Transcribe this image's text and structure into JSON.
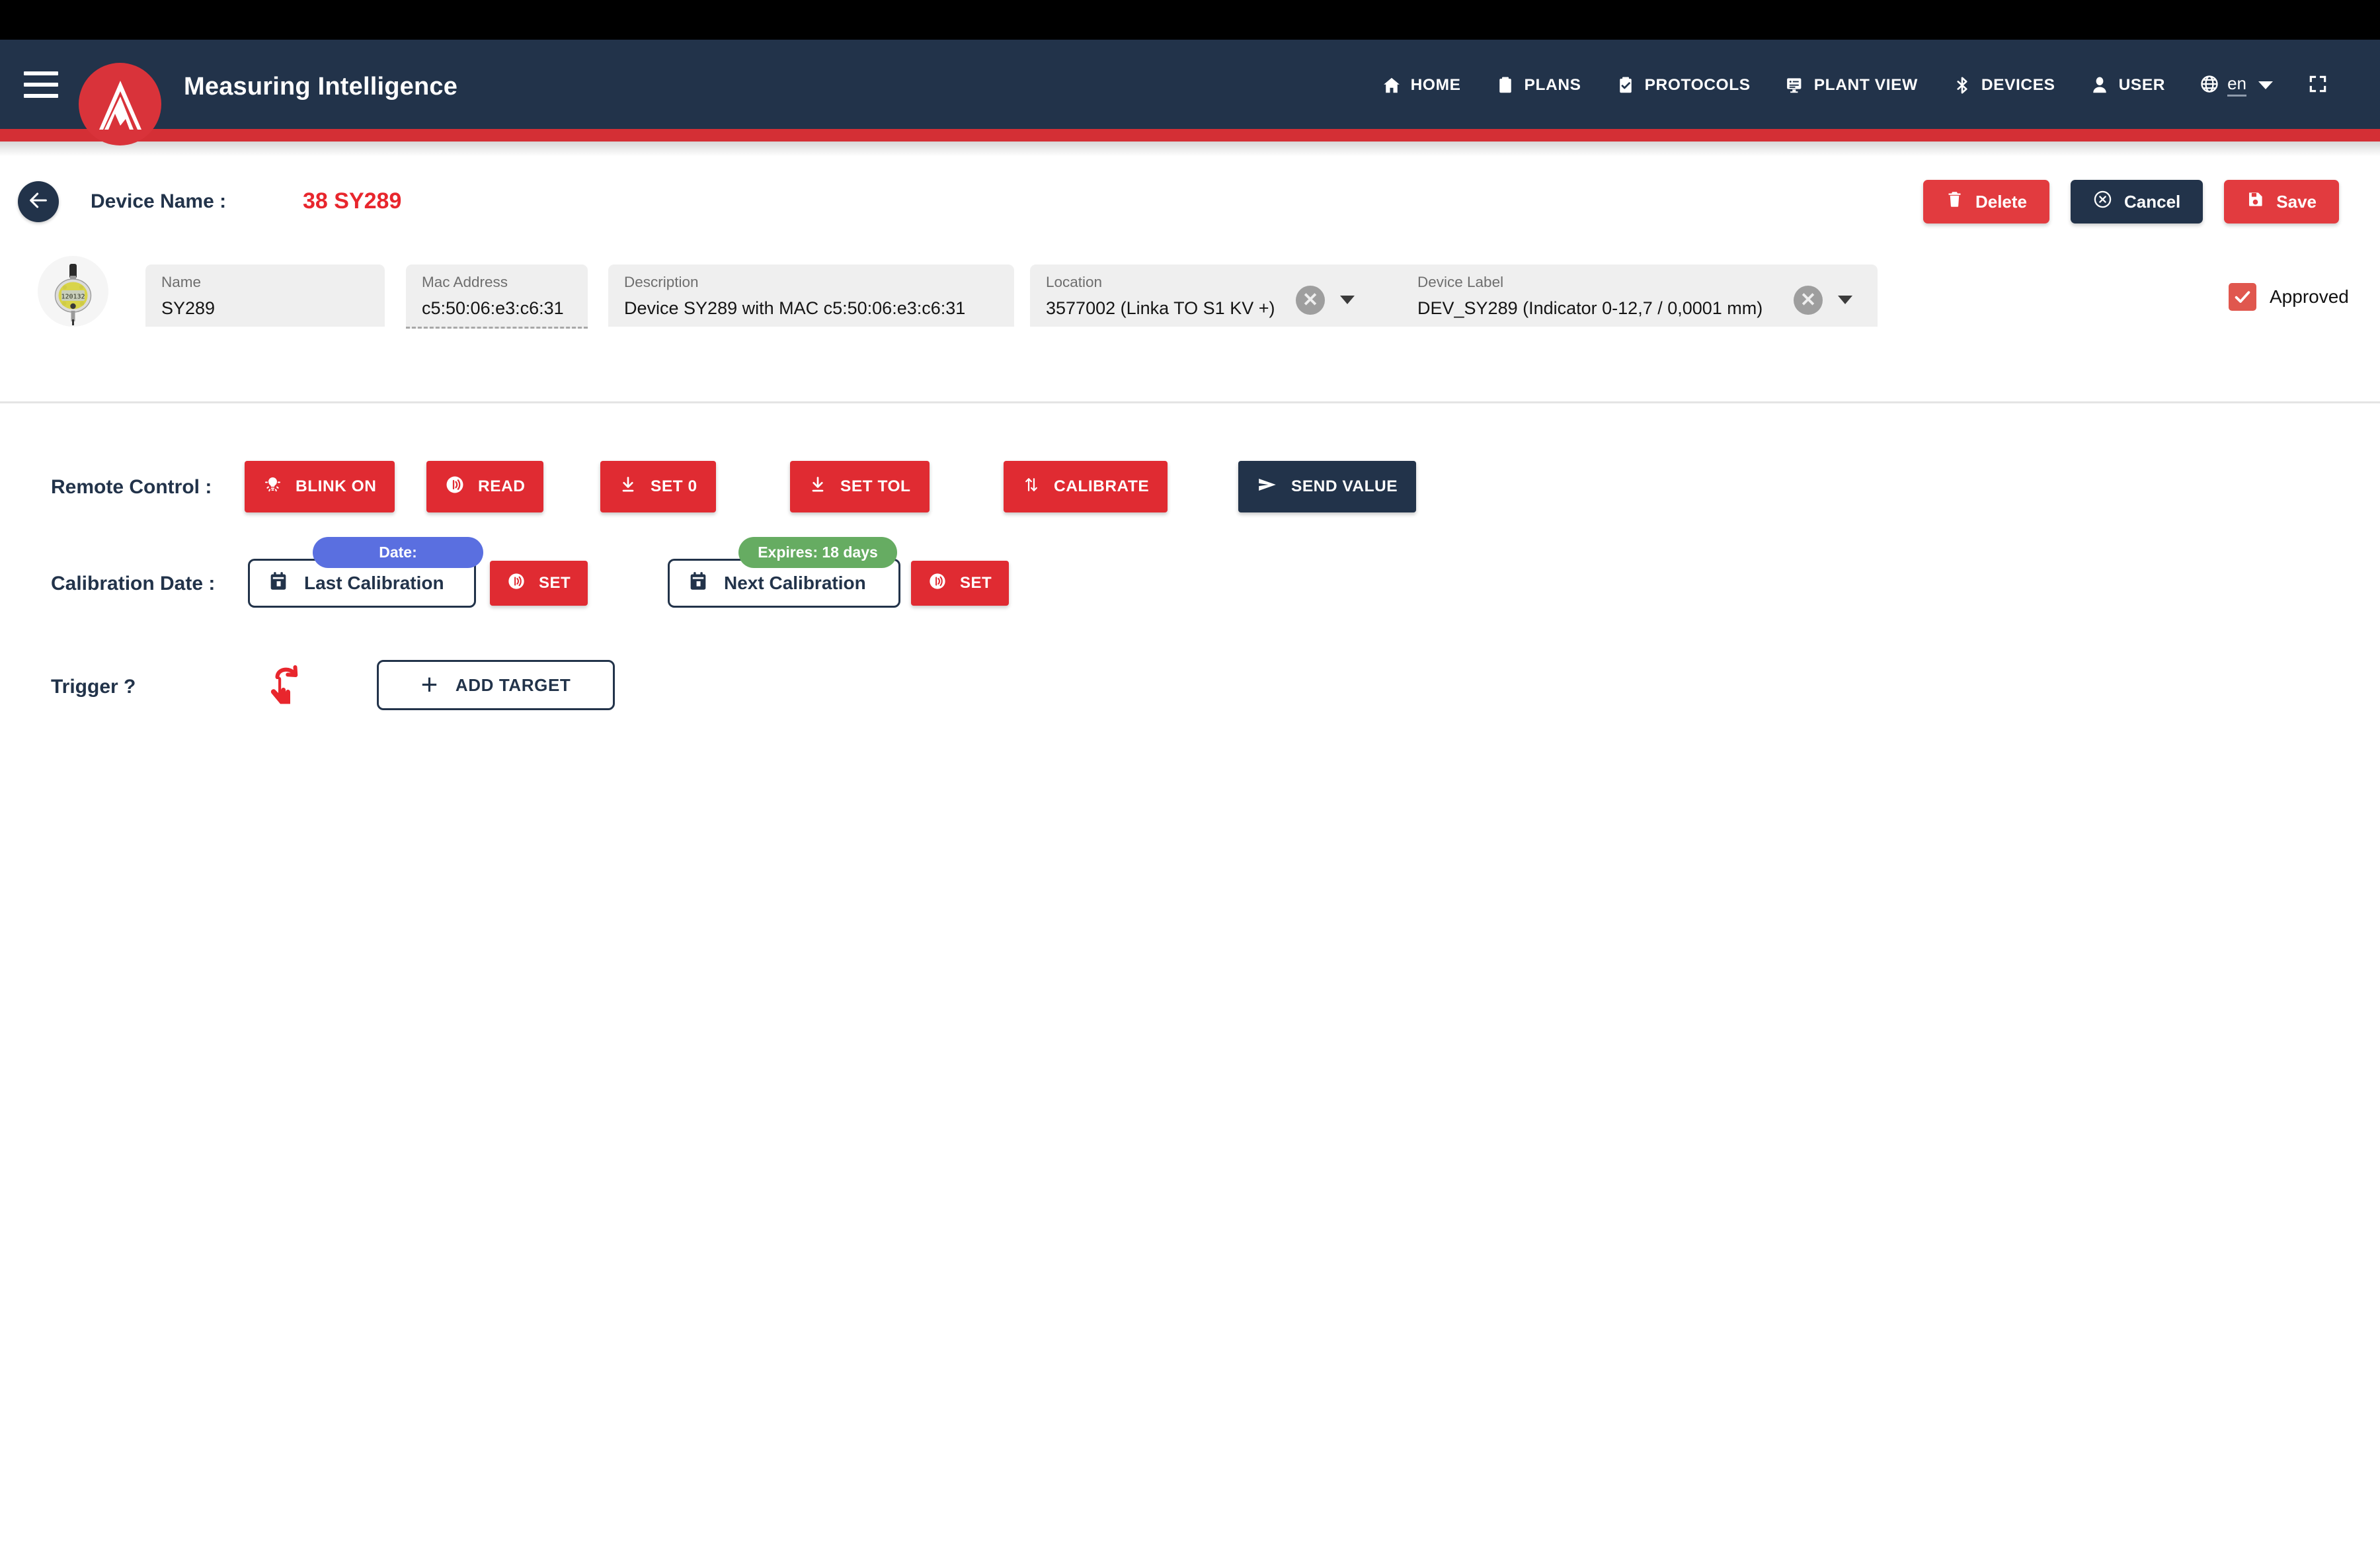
{
  "app": {
    "title": "Measuring Intelligence",
    "logo_icon": "mountain-peak-logo",
    "menu_icon": "hamburger-menu-icon",
    "accent_red": "#d42f35",
    "navy": "#22334a"
  },
  "nav": {
    "items": [
      {
        "label": "HOME",
        "icon": "home-icon"
      },
      {
        "label": "PLANS",
        "icon": "clipboard-icon"
      },
      {
        "label": "PROTOCOLS",
        "icon": "clipboard-check-icon"
      },
      {
        "label": "PLANT VIEW",
        "icon": "plant-view-icon"
      },
      {
        "label": "DEVICES",
        "icon": "bluetooth-icon"
      },
      {
        "label": "USER",
        "icon": "person-icon"
      }
    ],
    "language": {
      "value": "en",
      "icon": "globe-icon",
      "caret": "chevron-down-icon"
    },
    "fullscreen_icon": "fullscreen-icon"
  },
  "header": {
    "back_icon": "arrow-left-icon",
    "device_name_label": "Device Name :",
    "device_name_value": "38 SY289",
    "actions": [
      {
        "label": "Delete",
        "icon": "trash-icon",
        "style": "red"
      },
      {
        "label": "Cancel",
        "icon": "circle-x-icon",
        "style": "dark"
      },
      {
        "label": "Save",
        "icon": "save-disk-icon",
        "style": "red"
      }
    ]
  },
  "device": {
    "thumbnail_icon": "dial-indicator-thumbnail",
    "fields": [
      {
        "label": "Name",
        "value": "SY289",
        "type": "text",
        "disabled": false
      },
      {
        "label": "Mac Address",
        "value": "c5:50:06:e3:c6:31",
        "type": "text",
        "disabled": true
      },
      {
        "label": "Description",
        "value": "Device SY289 with MAC c5:50:06:e3:c6:31",
        "type": "text",
        "disabled": false
      },
      {
        "label": "Location",
        "value": "3577002 (Linka TO S1 KV +)",
        "type": "select",
        "disabled": false
      },
      {
        "label": "Device Label",
        "value": "DEV_SY289 (Indicator 0-12,7 / 0,0001 mm)",
        "type": "select",
        "disabled": false
      }
    ],
    "clear_icon": "clear-circle-icon",
    "dropdown_icon": "caret-down-icon",
    "approved": {
      "label": "Approved",
      "checked": true,
      "icon": "checkmark-icon",
      "color": "#e0574e"
    }
  },
  "remote_control": {
    "label": "Remote Control :",
    "buttons": [
      {
        "label": "BLINK ON",
        "icon": "lightbulb-icon",
        "style": "red"
      },
      {
        "label": "READ",
        "icon": "signal-wave-icon",
        "style": "red"
      },
      {
        "label": "SET 0",
        "icon": "download-icon",
        "style": "red"
      },
      {
        "label": "SET TOL",
        "icon": "download-icon",
        "style": "red"
      },
      {
        "label": "CALIBRATE",
        "icon": "up-down-arrows-icon",
        "style": "red"
      },
      {
        "label": "SEND VALUE",
        "icon": "send-icon",
        "style": "dark"
      }
    ]
  },
  "calibration": {
    "label": "Calibration Date :",
    "last": {
      "button_label": "Last Calibration",
      "icon": "calendar-icon",
      "badge": {
        "text": "Date:",
        "color": "#5a6fe0"
      },
      "set_label": "SET",
      "set_icon": "signal-wave-icon"
    },
    "next": {
      "button_label": "Next Calibration",
      "icon": "calendar-icon",
      "badge": {
        "text": "Expires: 18 days",
        "color": "#66ac62"
      },
      "set_label": "SET",
      "set_icon": "signal-wave-icon"
    }
  },
  "trigger": {
    "label": "Trigger ?",
    "icon": "touch-gesture-icon",
    "add_target_label": "ADD TARGET",
    "add_target_icon": "plus-icon"
  }
}
